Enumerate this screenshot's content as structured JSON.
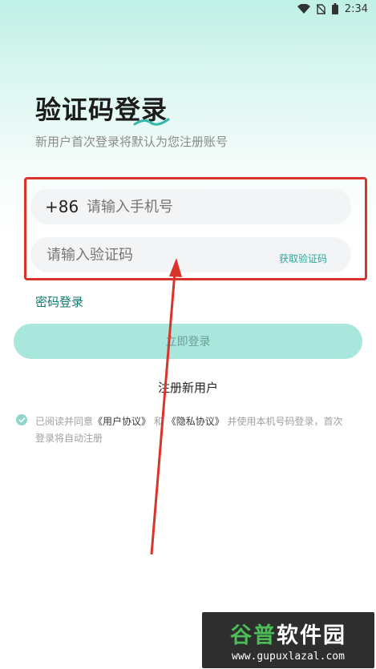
{
  "status_bar": {
    "time": "2:34"
  },
  "header": {
    "title": "验证码登录",
    "subtitle": "新用户首次登录将默认为您注册账号"
  },
  "form": {
    "country_code": "+86",
    "phone_placeholder": "请输入手机号",
    "code_placeholder": "请输入验证码",
    "get_code_label": "获取验证码"
  },
  "password_login_label": "密码登录",
  "login_button_label": "立即登录",
  "register_label": "注册新用户",
  "agreement": {
    "prefix": "已阅读并同意",
    "user_agreement": "《用户协议》",
    "and": "和",
    "privacy_policy": "《隐私协议》",
    "suffix": "并使用本机号码登录，首次登录将自动注册"
  },
  "watermark": {
    "brand_green": "谷普",
    "brand_white": "软件园",
    "url": "www.gupuxlazal.com"
  },
  "colors": {
    "accent": "#2ba79a",
    "button": "#a9e6db",
    "annotation": "#d9342b"
  }
}
